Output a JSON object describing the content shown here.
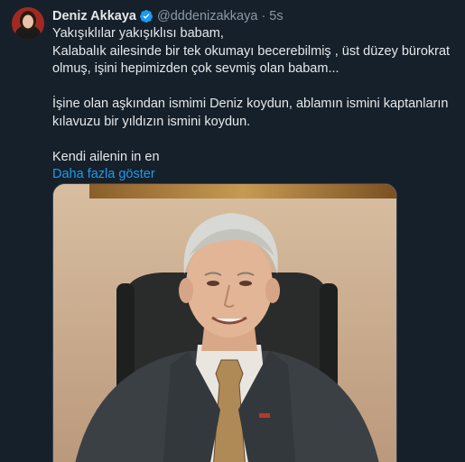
{
  "tweet": {
    "author_name": "Deniz Akkaya",
    "handle": "@dddenizakkaya",
    "separator": "·",
    "time": "5s",
    "lines": [
      "Yakışıklılar yakışıklısı babam,",
      "Kalabalık ailesinde bir tek okumayı becerebilmiş , üst düzey bürokrat",
      "olmuş, işini hepimizden çok sevmiş olan babam...",
      "",
      "İşine olan aşkından ismimi Deniz koydun, ablamın ismini kaptanların",
      "kılavuzu bir yıldızın ismini koydun.",
      "",
      "Kendi ailenin in en"
    ],
    "show_more": "Daha fazla göster"
  },
  "colors": {
    "background": "#15202b",
    "text": "#e7e9ea",
    "muted": "#8b98a5",
    "link": "#1d9bf0",
    "verified": "#1d9bf0"
  },
  "icons": {
    "verified": "verified-badge-icon"
  }
}
